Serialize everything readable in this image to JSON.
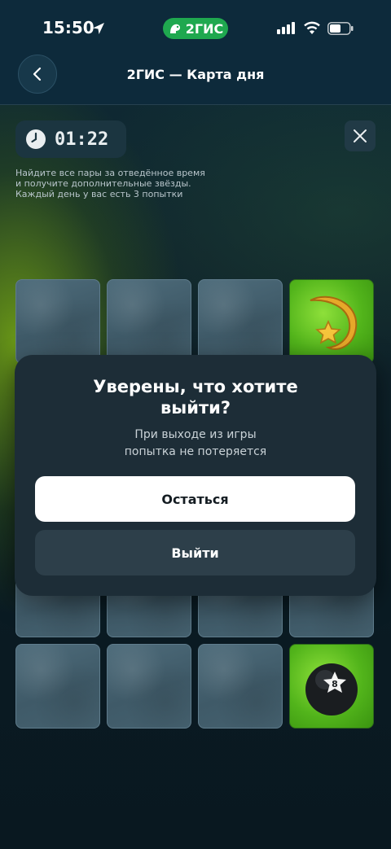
{
  "status_bar": {
    "time": "15:50",
    "brand": "2ГИС"
  },
  "header": {
    "title": "2ГИС — Карта дня",
    "back_icon": "chevron-left-icon"
  },
  "timer": {
    "value": "01:22",
    "icon": "clock-icon"
  },
  "hint": {
    "lines": [
      "Найдите все пары за отведённое время",
      "и получите дополнительные звёзды.",
      "Каждый день у вас есть 3 попытки"
    ]
  },
  "board": {
    "revealed_cards": [
      {
        "row": 1,
        "column": 4,
        "icon": "shooting-star-icon"
      },
      {
        "row": 4,
        "column": 4,
        "icon": "billiard-8-ball-icon"
      }
    ]
  },
  "dialog": {
    "title_line1": "Уверены, что хотите",
    "title_line2": "выйти?",
    "subtitle_line1": "При выходе из игры",
    "subtitle_line2": "попытка не потеряется",
    "stay_label": "Остаться",
    "exit_label": "Выйти"
  },
  "colors": {
    "brand_green": "#1fa84f",
    "card_open_green": "#52b41b",
    "dialog_bg": "#1d2d37"
  }
}
